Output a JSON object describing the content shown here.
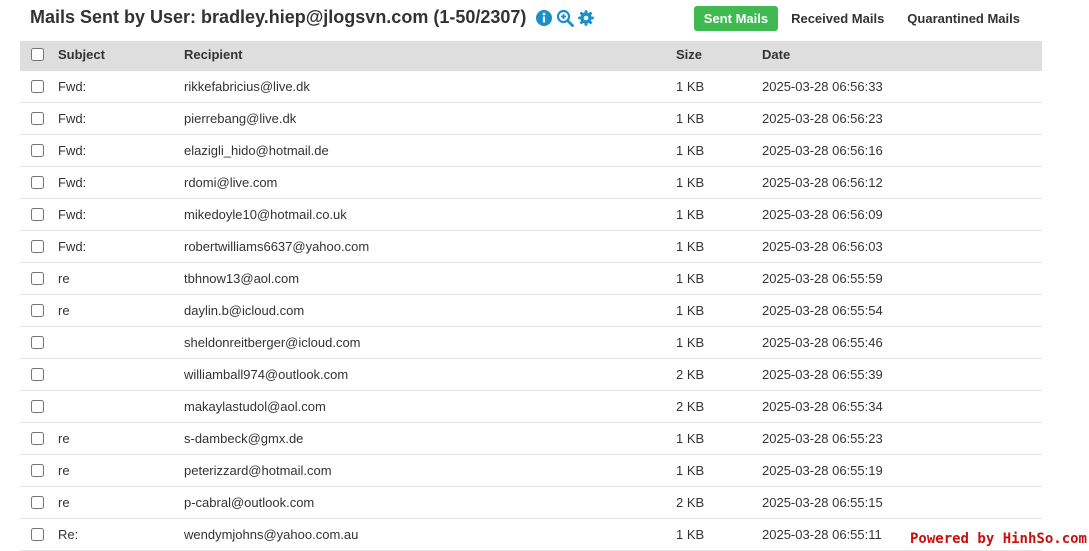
{
  "header": {
    "title": "Mails Sent by User: bradley.hiep@jlogsvn.com (1-50/2307)",
    "icons": [
      "info-icon",
      "zoom-in-icon",
      "gear-icon"
    ]
  },
  "tabs": [
    {
      "label": "Sent Mails",
      "active": true
    },
    {
      "label": "Received Mails",
      "active": false
    },
    {
      "label": "Quarantined Mails",
      "active": false
    }
  ],
  "table": {
    "columns": {
      "subject": "Subject",
      "recipient": "Recipient",
      "size": "Size",
      "date": "Date"
    },
    "rows": [
      {
        "subject": "Fwd:",
        "recipient": "rikkefabricius@live.dk",
        "size": "1 KB",
        "date": "2025-03-28 06:56:33"
      },
      {
        "subject": "Fwd:",
        "recipient": "pierrebang@live.dk",
        "size": "1 KB",
        "date": "2025-03-28 06:56:23"
      },
      {
        "subject": "Fwd:",
        "recipient": "elazigli_hido@hotmail.de",
        "size": "1 KB",
        "date": "2025-03-28 06:56:16"
      },
      {
        "subject": "Fwd:",
        "recipient": "rdomi@live.com",
        "size": "1 KB",
        "date": "2025-03-28 06:56:12"
      },
      {
        "subject": "Fwd:",
        "recipient": "mikedoyle10@hotmail.co.uk",
        "size": "1 KB",
        "date": "2025-03-28 06:56:09"
      },
      {
        "subject": "Fwd:",
        "recipient": "robertwilliams6637@yahoo.com",
        "size": "1 KB",
        "date": "2025-03-28 06:56:03"
      },
      {
        "subject": "re",
        "recipient": "tbhnow13@aol.com",
        "size": "1 KB",
        "date": "2025-03-28 06:55:59"
      },
      {
        "subject": "re",
        "recipient": "daylin.b@icloud.com",
        "size": "1 KB",
        "date": "2025-03-28 06:55:54"
      },
      {
        "subject": "",
        "recipient": "sheldonreitberger@icloud.com",
        "size": "1 KB",
        "date": "2025-03-28 06:55:46"
      },
      {
        "subject": "",
        "recipient": "williamball974@outlook.com",
        "size": "2 KB",
        "date": "2025-03-28 06:55:39"
      },
      {
        "subject": "",
        "recipient": "makaylastudol@aol.com",
        "size": "2 KB",
        "date": "2025-03-28 06:55:34"
      },
      {
        "subject": "re",
        "recipient": "s-dambeck@gmx.de",
        "size": "1 KB",
        "date": "2025-03-28 06:55:23"
      },
      {
        "subject": "re",
        "recipient": "peterizzard@hotmail.com",
        "size": "1 KB",
        "date": "2025-03-28 06:55:19"
      },
      {
        "subject": "re",
        "recipient": "p-cabral@outlook.com",
        "size": "2 KB",
        "date": "2025-03-28 06:55:15"
      },
      {
        "subject": "Re:",
        "recipient": "wendymjohns@yahoo.com.au",
        "size": "1 KB",
        "date": "2025-03-28 06:55:11"
      }
    ]
  },
  "watermark": "Powered by HinhSo.com",
  "colors": {
    "accent": "#3fb950",
    "icon": "#1a8fc9",
    "header_bg": "#dedede",
    "watermark": "#c81010"
  }
}
